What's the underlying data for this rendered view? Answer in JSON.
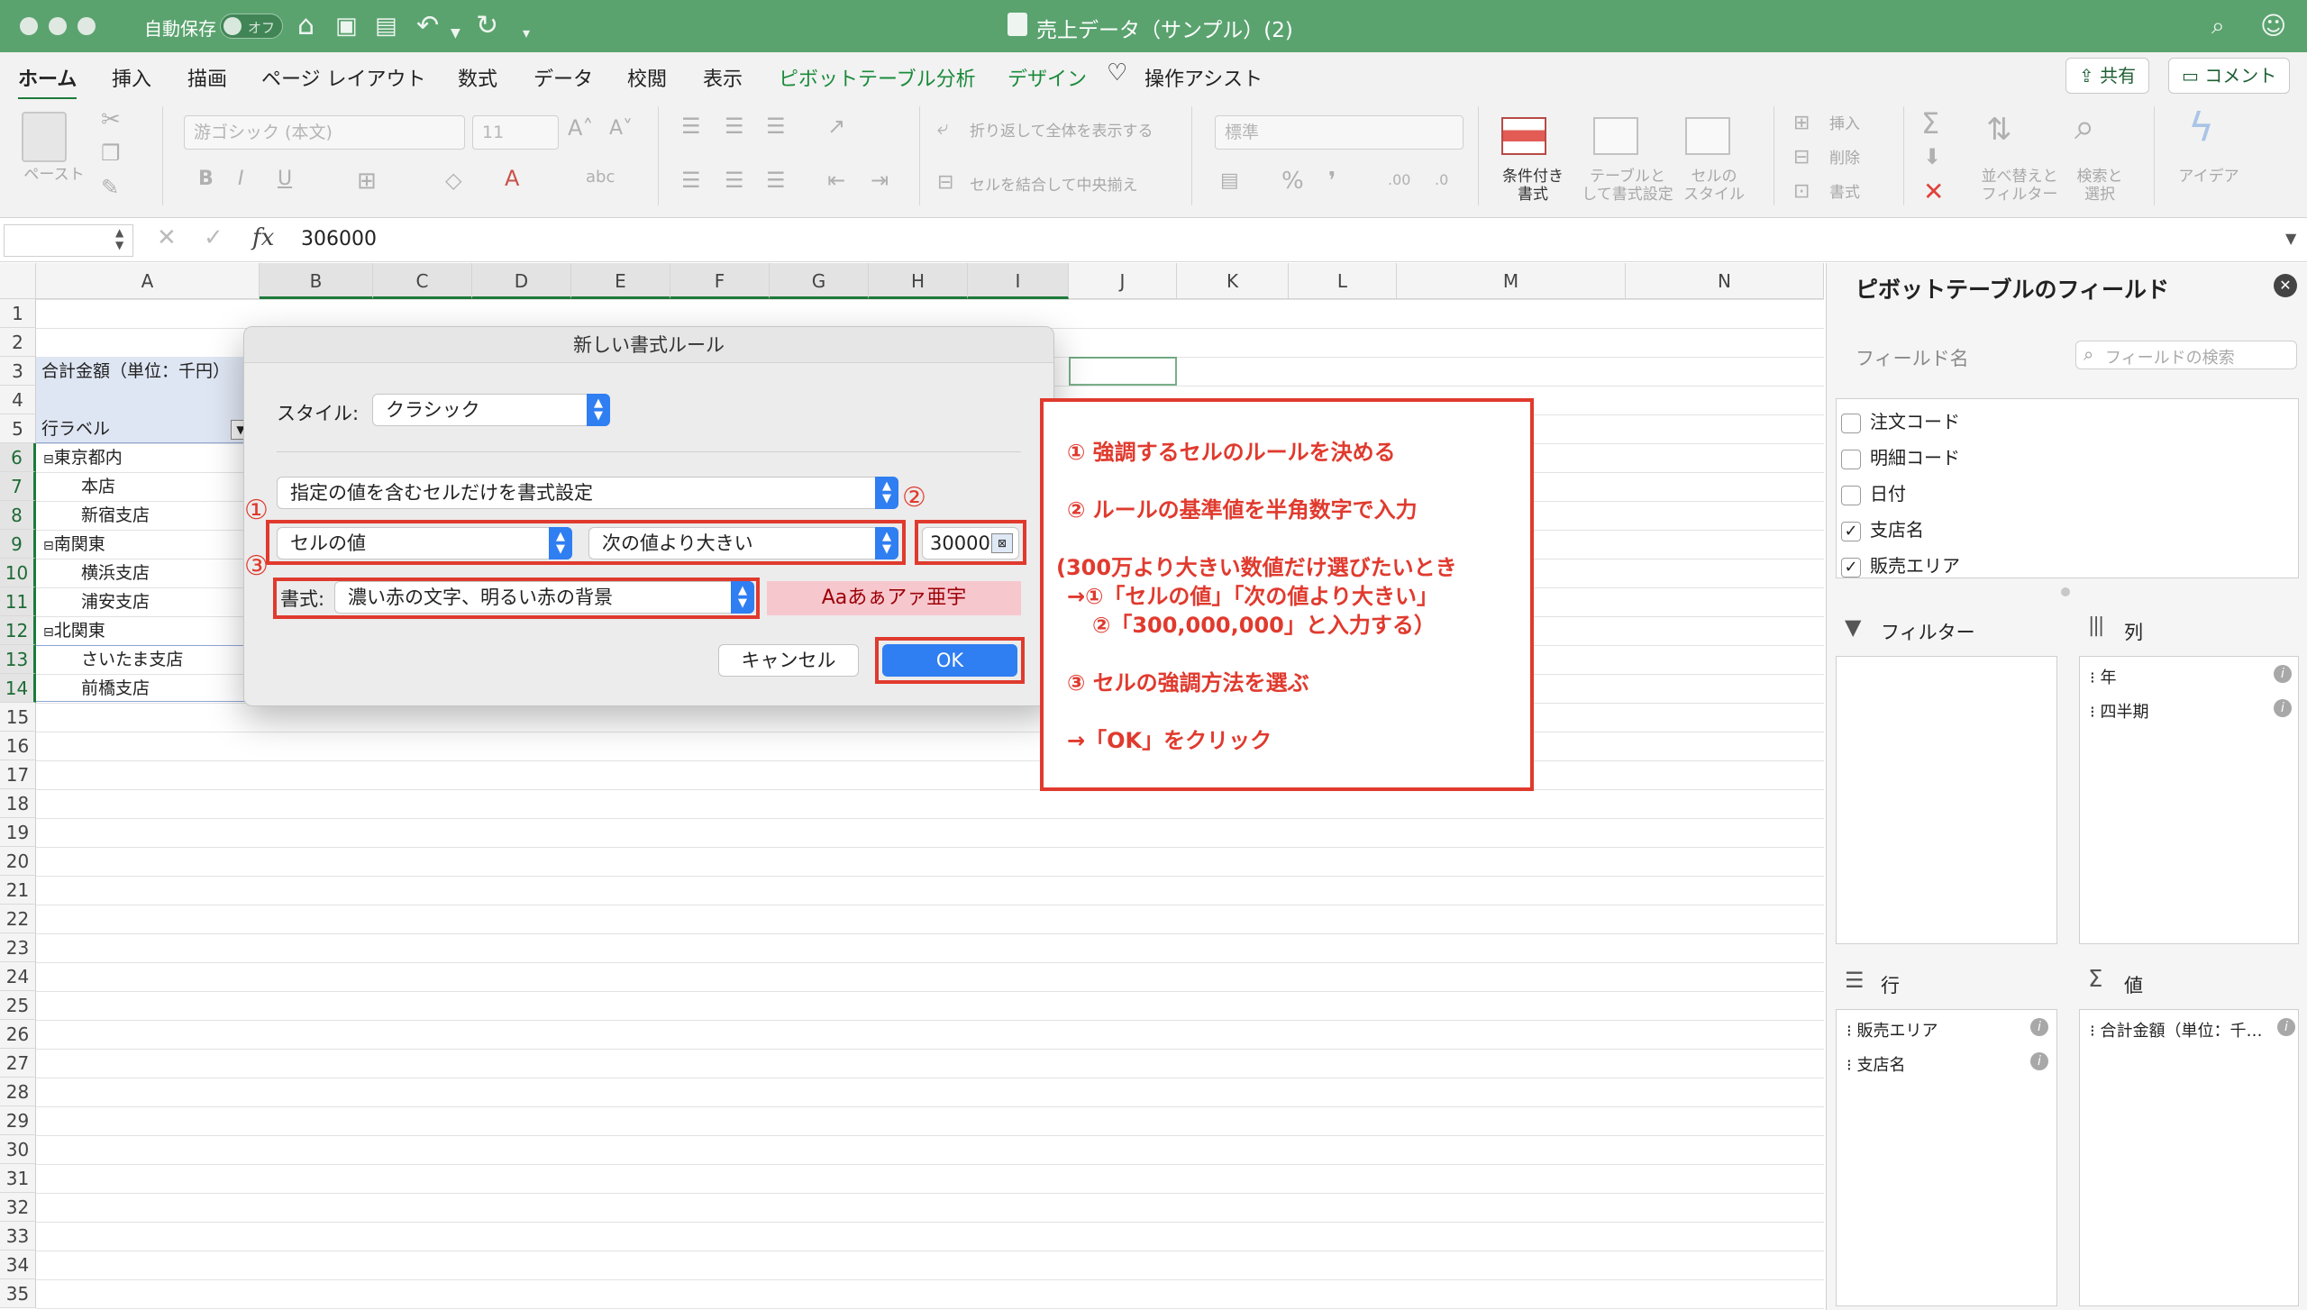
{
  "titlebar": {
    "autosave_label": "自動保存",
    "autosave_state": "オフ",
    "doc_title": "売上データ（サンプル）(2)"
  },
  "tabs": [
    "ホーム",
    "挿入",
    "描画",
    "ページ レイアウト",
    "数式",
    "データ",
    "校閲",
    "表示",
    "ピボットテーブル分析",
    "デザイン",
    "操作アシスト"
  ],
  "share_label": "共有",
  "comment_label": "コメント",
  "ribbon": {
    "paste": "ペースト",
    "font_name": "游ゴシック (本文)",
    "font_size": "11",
    "wrap": "折り返して全体を表示する",
    "merge": "セルを結合して中央揃え",
    "number_format": "標準",
    "cond_format": "条件付き\n書式",
    "table_format": "テーブルと\nして書式設定",
    "cell_style": "セルの\nスタイル",
    "insert": "挿入",
    "delete": "削除",
    "format": "書式",
    "sort_filter": "並べ替えと\nフィルター",
    "find_select": "検索と\n選択",
    "ideas": "アイデア"
  },
  "formula_bar": {
    "value": "306000"
  },
  "columns": [
    "A",
    "B",
    "C",
    "D",
    "E",
    "F",
    "G",
    "H",
    "I",
    "J",
    "K",
    "L",
    "M",
    "N"
  ],
  "rows": [
    "1",
    "2",
    "3",
    "4",
    "5",
    "6",
    "7",
    "8",
    "9",
    "10",
    "11",
    "12",
    "13",
    "14",
    "15",
    "16",
    "17",
    "18",
    "19",
    "20",
    "21",
    "22",
    "23",
    "24",
    "25",
    "26",
    "27",
    "28",
    "29",
    "30",
    "31",
    "32",
    "33",
    "34",
    "35"
  ],
  "cells": {
    "a3": "合計金額（単位：千円）",
    "a5": "行ラベル",
    "a6": "東京都内",
    "a7": "本店",
    "a8": "新宿支店",
    "a9": "南関東",
    "a10": "横浜支店",
    "a11": "浦安支店",
    "a12": "北関東",
    "a13": "さいたま支店",
    "a14": "前橋支店"
  },
  "dialog": {
    "title": "新しい書式ルール",
    "style_label": "スタイル:",
    "style_value": "クラシック",
    "rule_type": "指定の値を含むセルだけを書式設定",
    "cond1": "セルの値",
    "cond2": "次の値より大きい",
    "value": "30000",
    "format_label": "書式:",
    "format_value": "濃い赤の文字、明るい赤の背景",
    "preview": "Aaあぁアァ亜宇",
    "cancel": "キャンセル",
    "ok": "OK",
    "marker1": "①",
    "marker2": "②",
    "marker3": "③"
  },
  "annotation": {
    "line1": "① 強調するセルのルールを決める",
    "line2": "② ルールの基準値を半角数字で入力",
    "line3": "(300万より大きい数値だけ選びたいとき",
    "line4": "→①「セルの値」「次の値より大きい」",
    "line5": "②「300,000,000」と入力する）",
    "line6": "③ セルの強調方法を選ぶ",
    "line7": "→「OK」をクリック"
  },
  "panel": {
    "title": "ピボットテーブルのフィールド",
    "field_name": "フィールド名",
    "search_placeholder": "フィールドの検索",
    "fields": [
      {
        "label": "注文コード",
        "checked": false
      },
      {
        "label": "明細コード",
        "checked": false
      },
      {
        "label": "日付",
        "checked": false
      },
      {
        "label": "支店名",
        "checked": true
      },
      {
        "label": "販売エリア",
        "checked": true
      }
    ],
    "filter": "フィルター",
    "columns": "列",
    "rows": "行",
    "values": "値",
    "col_items": [
      "年",
      "四半期"
    ],
    "row_items": [
      "販売エリア",
      "支店名"
    ],
    "value_items": [
      "合計金額（単位：千…"
    ]
  },
  "colors": {
    "titlebar": "#5aa36f",
    "accent": "#1e7a3b",
    "annotation": "#e03a2e",
    "button": "#2f7ef2"
  }
}
